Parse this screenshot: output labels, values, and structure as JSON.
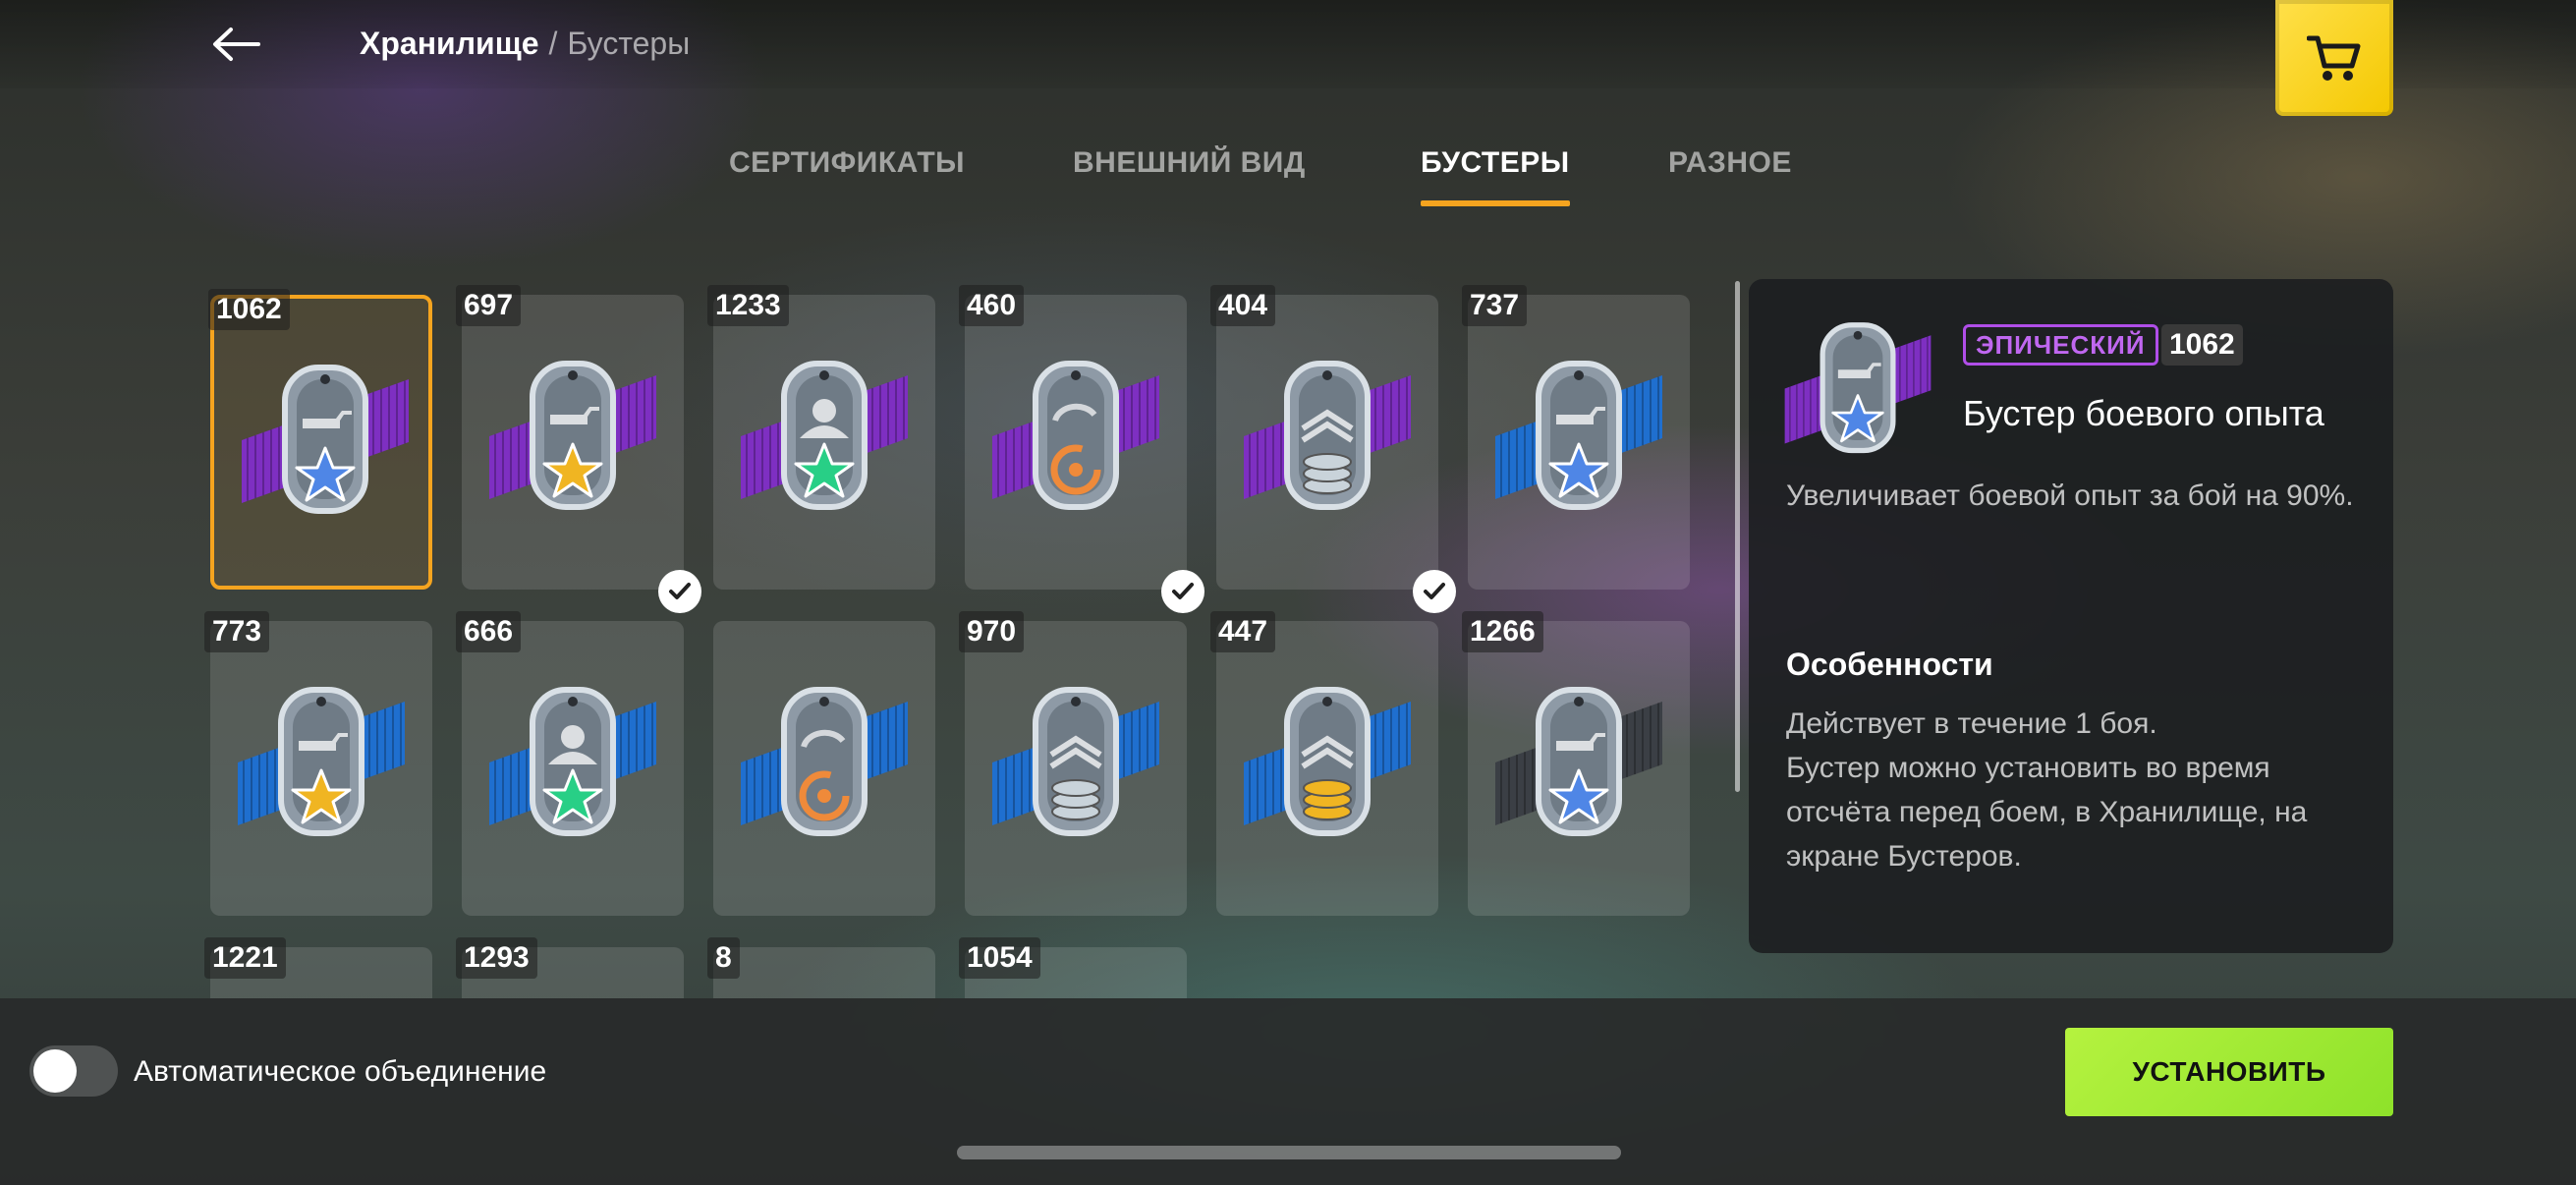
{
  "header": {
    "breadcrumb_root": "Хранилище",
    "breadcrumb_separator": "/",
    "breadcrumb_current": "Бустеры",
    "back_icon": "arrow-left-icon",
    "cart_icon": "cart-icon",
    "cart_color": "#f7d20a"
  },
  "tabs": [
    {
      "label": "СЕРТИФИКАТЫ",
      "active": false
    },
    {
      "label": "ВНЕШНИЙ ВИД",
      "active": false
    },
    {
      "label": "БУСТЕРЫ",
      "active": true
    },
    {
      "label": "РАЗНОЕ",
      "active": false
    }
  ],
  "accent_color": "#f5a41f",
  "boosters": [
    {
      "count": "1062",
      "symbol": "star",
      "symbol_color": "blue",
      "ribbon": "purple",
      "icon": "tank-icon",
      "selected": true,
      "checked": false
    },
    {
      "count": "697",
      "symbol": "star",
      "symbol_color": "gold",
      "ribbon": "purple",
      "icon": "tank-icon",
      "selected": false,
      "checked": true
    },
    {
      "count": "1233",
      "symbol": "star",
      "symbol_color": "green",
      "ribbon": "purple",
      "icon": "crew-icon",
      "selected": false,
      "checked": false
    },
    {
      "count": "460",
      "symbol": "cycle",
      "symbol_color": "orange",
      "ribbon": "purple",
      "icon": "reload-icon",
      "selected": false,
      "checked": true
    },
    {
      "count": "404",
      "symbol": "coins",
      "symbol_color": "silver",
      "ribbon": "purple",
      "icon": "chevron-icon",
      "selected": false,
      "checked": true
    },
    {
      "count": "737",
      "symbol": "star",
      "symbol_color": "blue",
      "ribbon": "blue",
      "icon": "tank-icon",
      "selected": false,
      "checked": false
    },
    {
      "count": "773",
      "symbol": "star",
      "symbol_color": "gold",
      "ribbon": "blue",
      "icon": "tank-icon",
      "selected": false,
      "checked": false
    },
    {
      "count": "666",
      "symbol": "star",
      "symbol_color": "green",
      "ribbon": "blue",
      "icon": "crew-icon",
      "selected": false,
      "checked": false
    },
    {
      "count": "",
      "symbol": "cycle",
      "symbol_color": "orange",
      "ribbon": "blue",
      "icon": "reload-icon",
      "selected": false,
      "checked": false
    },
    {
      "count": "970",
      "symbol": "coins",
      "symbol_color": "silver",
      "ribbon": "blue",
      "icon": "chevron-icon",
      "selected": false,
      "checked": false
    },
    {
      "count": "447",
      "symbol": "coins",
      "symbol_color": "gold",
      "ribbon": "blue",
      "icon": "chevron-icon",
      "selected": false,
      "checked": false
    },
    {
      "count": "1266",
      "symbol": "star",
      "symbol_color": "blue",
      "ribbon": "gray",
      "icon": "tank-icon",
      "selected": false,
      "checked": false
    },
    {
      "count": "1221",
      "symbol": "",
      "symbol_color": "",
      "ribbon": "",
      "icon": "",
      "selected": false,
      "checked": false
    },
    {
      "count": "1293",
      "symbol": "",
      "symbol_color": "",
      "ribbon": "",
      "icon": "",
      "selected": false,
      "checked": false
    },
    {
      "count": "8",
      "symbol": "",
      "symbol_color": "",
      "ribbon": "",
      "icon": "",
      "selected": false,
      "checked": false
    },
    {
      "count": "1054",
      "symbol": "",
      "symbol_color": "",
      "ribbon": "",
      "icon": "",
      "selected": false,
      "checked": false
    }
  ],
  "detail": {
    "rarity": "ЭПИЧЕСКИЙ",
    "rarity_color": "#b04ee8",
    "count": "1062",
    "title": "Бустер боевого опыта",
    "description": "Увеличивает боевой опыт за бой на 90%.",
    "features_heading": "Особенности",
    "features_text": "Действует в течение 1 боя.\nБустер можно установить во время отсчёта перед боем, в Хранилище, на экране Бустеров."
  },
  "footer": {
    "auto_merge_label": "Автоматическое объединение",
    "auto_merge_on": false,
    "install_label": "УСТАНОВИТЬ",
    "install_color": "#a6ec35"
  }
}
